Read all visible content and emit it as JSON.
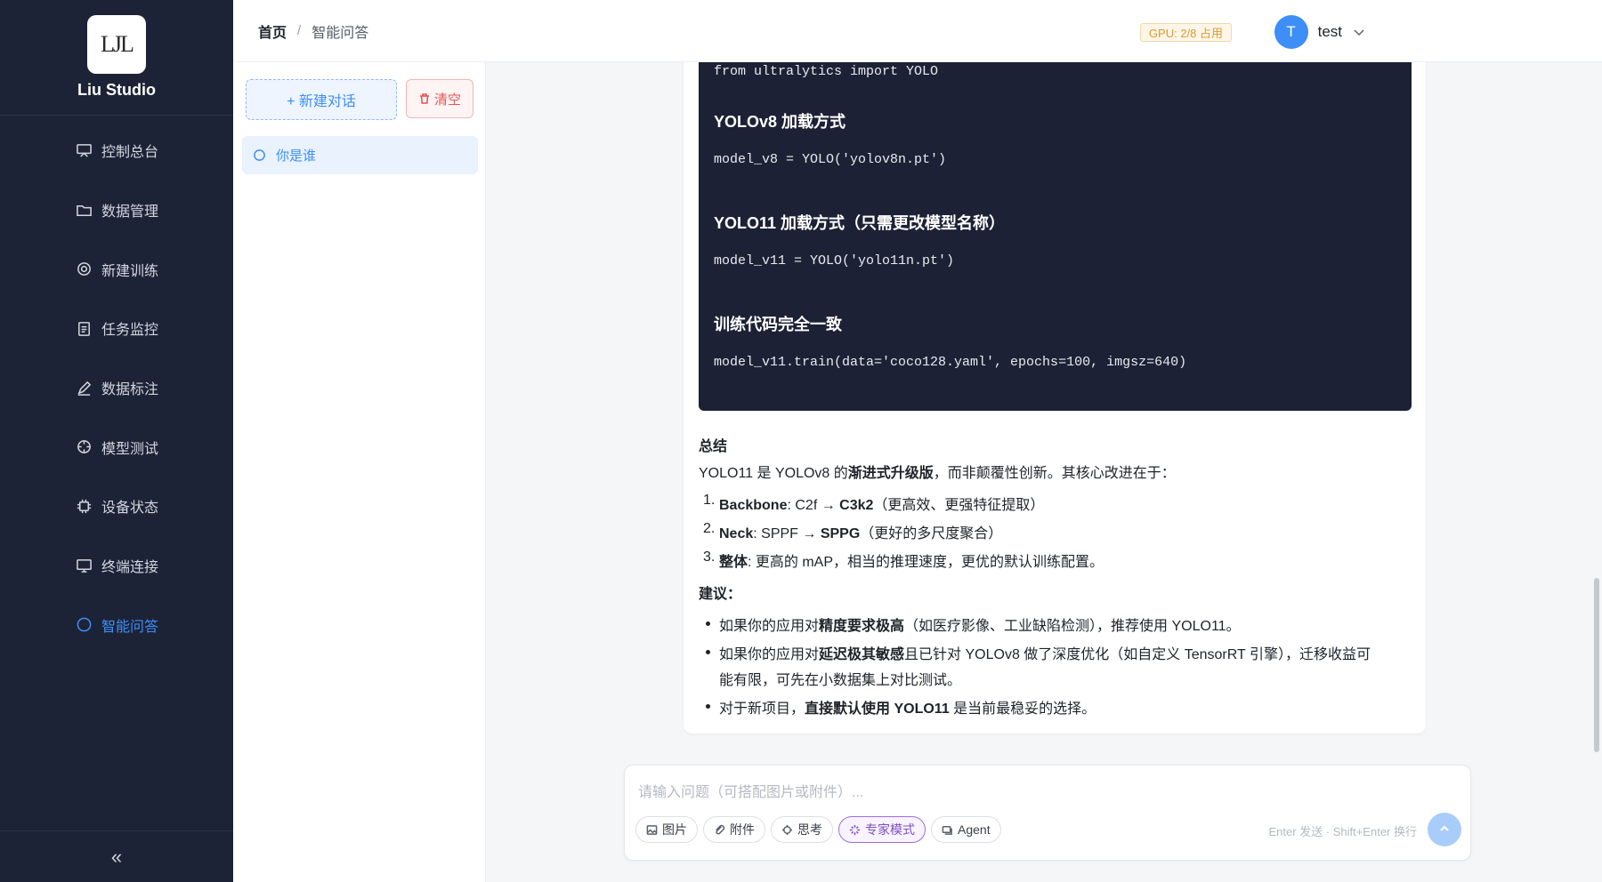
{
  "brand": {
    "logo_text": "LJL",
    "name": "Liu Studio"
  },
  "sidebar": {
    "items": [
      {
        "label": "控制总台",
        "icon": "monitor-flag-icon"
      },
      {
        "label": "数据管理",
        "icon": "folder-icon"
      },
      {
        "label": "新建训练",
        "icon": "gear-icon"
      },
      {
        "label": "任务监控",
        "icon": "clipboard-icon"
      },
      {
        "label": "数据标注",
        "icon": "pen-icon"
      },
      {
        "label": "模型测试",
        "icon": "crosshair-icon"
      },
      {
        "label": "设备状态",
        "icon": "chip-icon"
      },
      {
        "label": "终端连接",
        "icon": "desktop-icon"
      },
      {
        "label": "智能问答",
        "icon": "chat-icon",
        "active": true
      }
    ],
    "collapse_glyph": "«"
  },
  "header": {
    "breadcrumb_home": "首页",
    "breadcrumb_sep": "/",
    "breadcrumb_current": "智能问答",
    "gpu_badge": "GPU: 2/8 占用",
    "user_initial": "T",
    "user_name": "test"
  },
  "conversations": {
    "new_label": "+ 新建对话",
    "clear_label": "清空",
    "items": [
      {
        "title": "你是谁"
      }
    ]
  },
  "message": {
    "code_lines": [
      "from ultralytics import YOLO",
      "YOLOv8 加载方式",
      "model_v8 = YOLO('yolov8n.pt')",
      "YOLO11 加载方式（只需更改模型名称）",
      "model_v11 = YOLO('yolo11n.pt')",
      "训练代码完全一致",
      "model_v11.train(data='coco128.yaml', epochs=100, imgsz=640)"
    ],
    "summary_heading": "总结",
    "summary_pre": "YOLO11 是 YOLOv8 的",
    "summary_bold": "渐进式升级版",
    "summary_post": "，而非颠覆性创新。其核心改进在于：",
    "list": [
      {
        "num": "1.",
        "bold": "Backbone",
        "text": ": C2f → ",
        "bold2": "C3k2",
        "text2": "（更高效、更强特征提取）"
      },
      {
        "num": "2.",
        "bold": "Neck",
        "text": ": SPPF → ",
        "bold2": "SPPG",
        "text2": "（更好的多尺度聚合）"
      },
      {
        "num": "3.",
        "bold": "整体",
        "text": ": 更高的 mAP，相当的推理速度，更优的默认训练配置。",
        "bold2": "",
        "text2": ""
      }
    ],
    "advice_heading": "建议：",
    "bullets": [
      {
        "pre": "如果你的应用对",
        "bold": "精度要求极高",
        "post": "（如医疗影像、工业缺陷检测），推荐使用 YOLO11。"
      },
      {
        "pre": "如果你的应用对",
        "bold": "延迟极其敏感",
        "post": "且已针对 YOLOv8 做了深度优化（如自定义 TensorRT 引擎），迁移收益可",
        "cont": "能有限，可先在小数据集上对比测试。"
      },
      {
        "pre": "对于新项目，",
        "bold": "直接默认使用 YOLO11",
        "post": " 是当前最稳妥的选择。"
      }
    ]
  },
  "input": {
    "placeholder": "请输入问题（可搭配图片或附件）...",
    "tools": [
      "图片",
      "附件",
      "思考",
      "专家模式",
      "Agent"
    ],
    "hint": "Enter 发送 · Shift+Enter 换行"
  }
}
